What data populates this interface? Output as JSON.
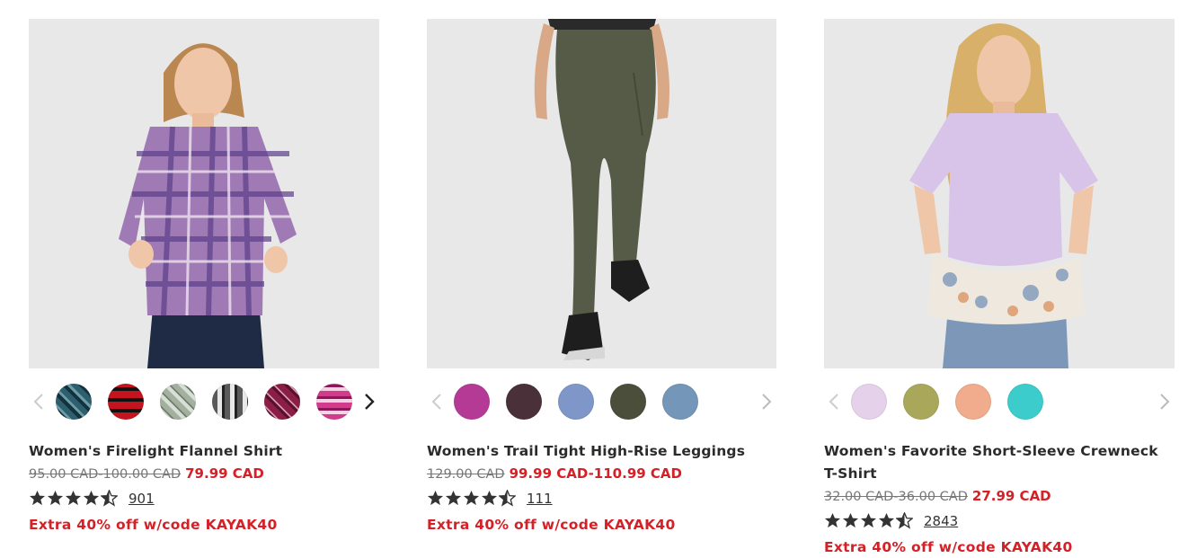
{
  "products": [
    {
      "name": "Women's Firelight Flannel Shirt",
      "original_price": "95.00 CAD-100.00 CAD",
      "sale_price": "79.99 CAD",
      "rating": 4.5,
      "review_count": "901",
      "promo": "Extra 40% off w/code KAYAK40",
      "swatch_colors": [
        "#2e5f6e",
        "#c41420",
        "#a3b0a0",
        "#5a5a5a",
        "#8b1e45",
        "#d23c8c"
      ],
      "prev_arrow_color": "#cccccc",
      "next_arrow_color": "#222222"
    },
    {
      "name": "Women's Trail Tight High-Rise Leggings",
      "original_price": "129.00 CAD",
      "sale_price": "99.99 CAD-110.99 CAD",
      "rating": 4.5,
      "review_count": "111",
      "promo": "Extra 40% off w/code KAYAK40",
      "swatch_colors": [
        "#b43a96",
        "#4a3038",
        "#7e96c8",
        "#4b4e3b",
        "#7496b8"
      ],
      "prev_arrow_color": "#cccccc",
      "next_arrow_color": "#bbbbbb"
    },
    {
      "name": "Women's Favorite Short-Sleeve Crewneck T-Shirt",
      "original_price": "32.00 CAD-36.00 CAD",
      "sale_price": "27.99 CAD",
      "rating": 4.5,
      "review_count": "2843",
      "promo": "Extra 40% off w/code KAYAK40",
      "swatch_colors": [
        "#e6d1ea",
        "#a9a85a",
        "#f0ac8c",
        "#3ccccc"
      ],
      "prev_arrow_color": "#cccccc",
      "next_arrow_color": "#bbbbbb"
    }
  ],
  "colors": {
    "sale_red": "#d42127",
    "image_bg": "#e8e8e8",
    "star": "#333333"
  }
}
